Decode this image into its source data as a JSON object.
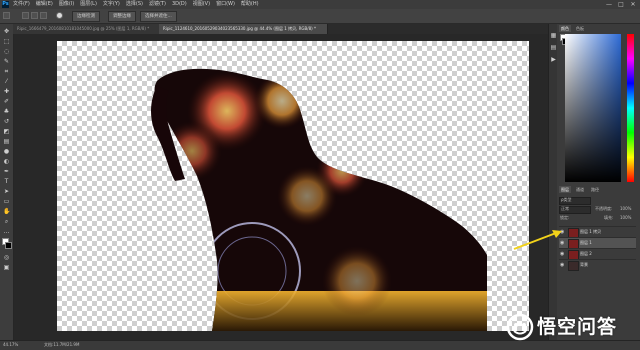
{
  "app": {
    "logo": "Ps",
    "menus": [
      "文件(F)",
      "编辑(E)",
      "图像(I)",
      "图层(L)",
      "文字(Y)",
      "选择(S)",
      "滤镜(T)",
      "3D(D)",
      "视图(V)",
      "窗口(W)",
      "帮助(H)"
    ],
    "window_controls": [
      "—",
      "□",
      "✕"
    ]
  },
  "options": {
    "btn_refine": "调整边缘",
    "btn_subject": "选择并遮住...",
    "btn_edge": "边缘检测",
    "icons": [
      "brush-icon",
      "add-selection-icon",
      "subtract-selection-icon",
      "brush-size-icon"
    ]
  },
  "tabs": [
    {
      "label": "Ripic_1666479_20160810181045000.jpg @ 25% (图层 1, RGB/8) *",
      "active": false
    },
    {
      "label": "Ripic_1124610_20160529034023565330.jpg @ 44.4% (图层 1 拷贝, RGB/8) *",
      "active": true
    }
  ],
  "status": {
    "zoom": "44.17%",
    "doc": "文档:11.7M/21.9M"
  },
  "panels": {
    "color_tabs": [
      "颜色",
      "色板"
    ],
    "layers_tabs": [
      "图层",
      "通道",
      "路径"
    ],
    "kind_label": "ρ类型",
    "blend_mode": "正常",
    "opacity_label": "不透明度:",
    "opacity_value": "100%",
    "lock_label": "锁定:",
    "fill_label": "填充:",
    "fill_value": "100%",
    "layers": [
      {
        "name": "图层 1 拷贝",
        "selected": false
      },
      {
        "name": "图层 1",
        "selected": true
      },
      {
        "name": "图层 2",
        "selected": false
      },
      {
        "name": "背景",
        "selected": false
      }
    ]
  },
  "watermark": {
    "text": "悟空问答"
  },
  "colors": {
    "arrow": "#f2d21a",
    "accent": "#31a8ff"
  }
}
